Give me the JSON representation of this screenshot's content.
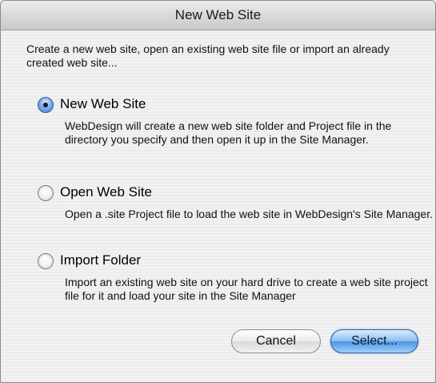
{
  "dialog": {
    "title": "New Web Site",
    "intro": "Create a new web site, open an existing web site file or import an already created web site..."
  },
  "options": [
    {
      "label": "New Web Site",
      "selected": true,
      "description": "WebDesign will create a new web site folder and Project file in the directory you specify and then open it up in the Site Manager."
    },
    {
      "label": "Open Web Site",
      "selected": false,
      "description": "Open a .site Project file to load the web site in WebDesign's Site Manager."
    },
    {
      "label": "Import Folder",
      "selected": false,
      "description": "Import an existing web site on your hard drive to create a web site project file for it and load your site in the Site Manager"
    }
  ],
  "buttons": {
    "cancel_label": "Cancel",
    "select_label": "Select..."
  },
  "colors": {
    "accent": "#4f95e3",
    "window_bg": "#ececec"
  }
}
